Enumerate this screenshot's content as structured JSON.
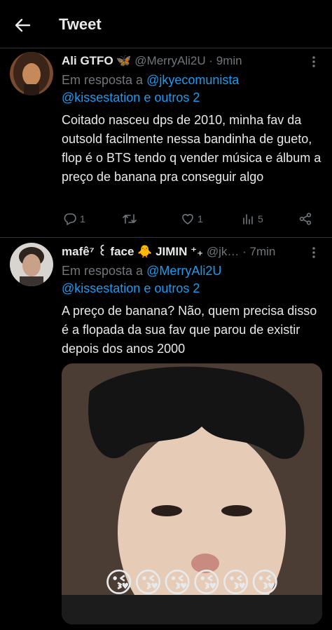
{
  "header": {
    "title": "Tweet",
    "back_icon": "arrow-left-icon"
  },
  "colors": {
    "link": "#1d9bf0",
    "muted": "#71767b",
    "text": "#e7e9ea",
    "background": "#000000"
  },
  "tweets": [
    {
      "display_name": "Ali GTFO 🦋",
      "handle": "@MerryAli2U",
      "dot": "·",
      "time": "9min",
      "reply_prefix": "Em resposta a",
      "reply_to_1": "@jkyecomunista",
      "reply_to_2": "@kissestation e outros 2",
      "text": "Coitado nasceu dps de 2010, minha fav da outsold facilmente nessa bandinha de gueto, flop é o BTS tendo q vender música e álbum a preço de banana pra conseguir algo",
      "reply_count": "1",
      "retweet_count": "",
      "like_count": "1",
      "view_count": "5"
    },
    {
      "display_name": "mafê⁷ ꒰ face 🐥 JIMIN ⁺₊",
      "handle": "@jk…",
      "dot": "·",
      "time": "7min",
      "reply_prefix": "Em resposta a",
      "reply_to_1": "@MerryAli2U",
      "reply_to_2": "@kissestation e outros 2",
      "text": "A preço de banana? Não, quem precisa disso é a flopada da sua fav que parou de existir depois dos anos 2000",
      "media_emojis": "😘😘😘😘😘😘"
    }
  ]
}
